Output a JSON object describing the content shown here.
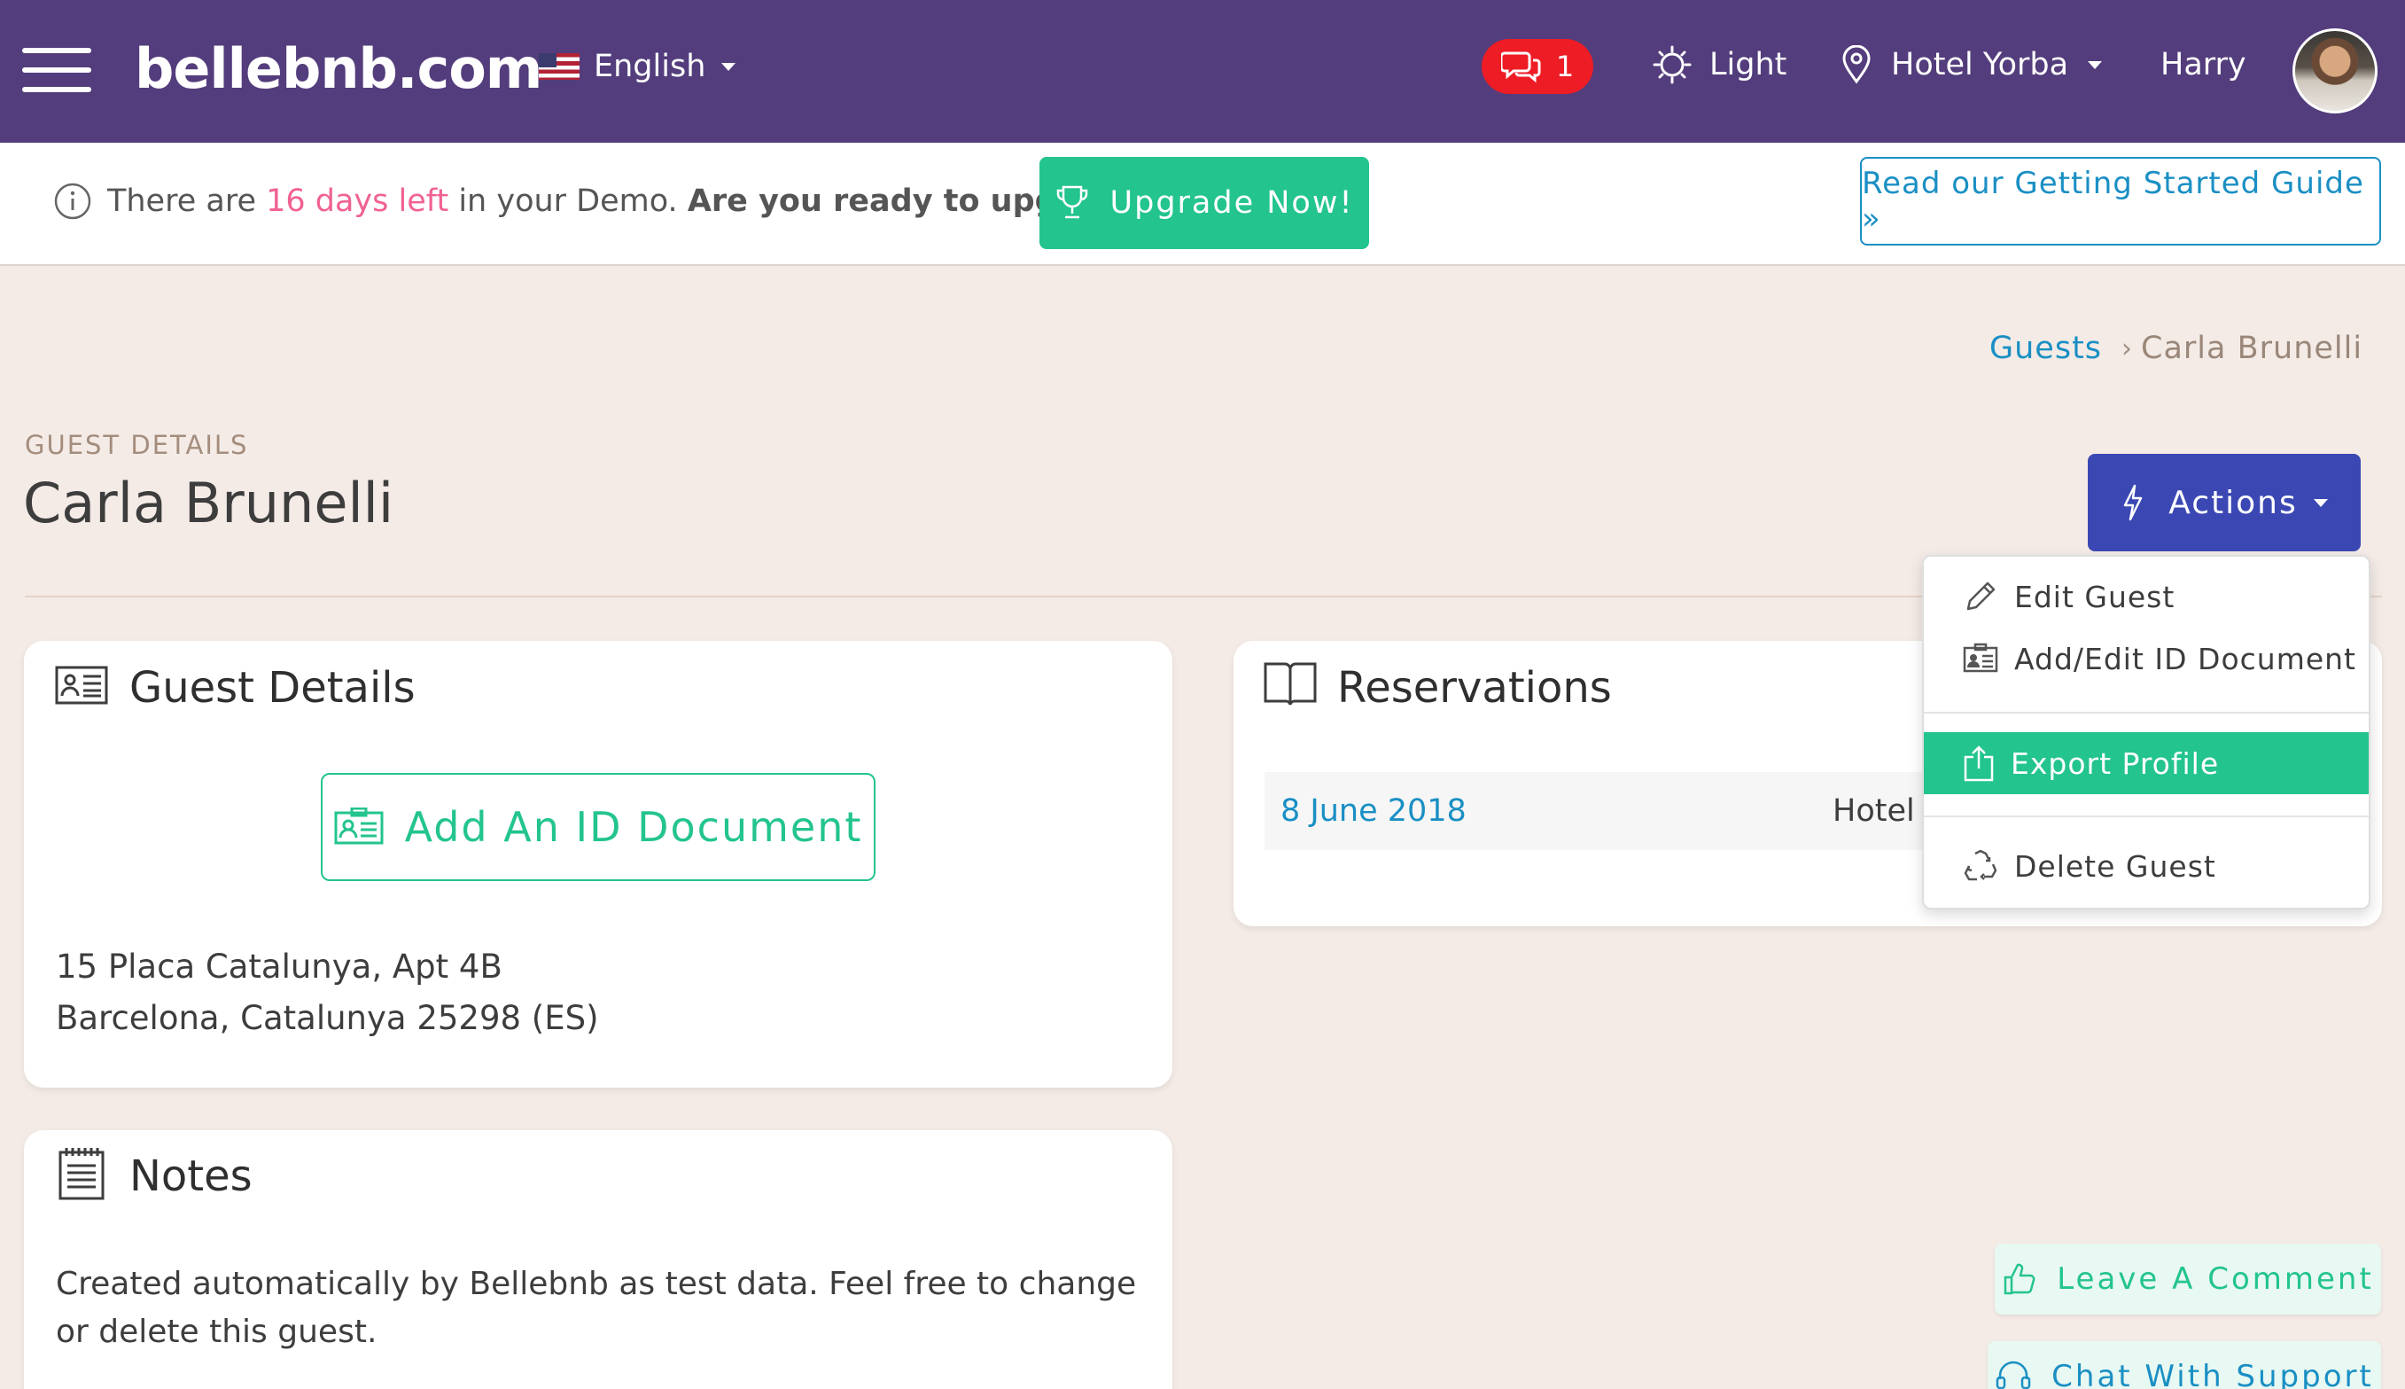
{
  "header": {
    "brand": "bellebnb.com",
    "language": "English",
    "chat_count": "1",
    "theme": "Light",
    "hotel": "Hotel Yorba",
    "user": "Harry",
    "icons": [
      "menu-icon",
      "flag-us-icon",
      "chat-icon",
      "sun-icon",
      "location-pin-icon",
      "avatar"
    ]
  },
  "banner": {
    "prefix": "There are ",
    "days_left": "16 days left",
    "middle": " in your Demo. ",
    "ask": "Are you ready to upgrade?",
    "upgrade_label": "Upgrade Now!",
    "guide_label": "Read our Getting Started Guide »"
  },
  "breadcrumb": {
    "parent": "Guests",
    "separator": "›",
    "current": "Carla Brunelli"
  },
  "page": {
    "section_label": "GUEST DETAILS",
    "title": "Carla Brunelli",
    "actions_label": "Actions"
  },
  "guest_card": {
    "title": "Guest Details",
    "add_id_label": "Add An ID Document",
    "address_line1": "15 Placa Catalunya, Apt 4B",
    "address_line2": "Barcelona, Catalunya 25298 (ES)"
  },
  "reservations_card": {
    "title": "Reservations",
    "rows": [
      {
        "date": "8 June 2018",
        "hotel": "Hotel Y"
      }
    ]
  },
  "notes_card": {
    "title": "Notes",
    "text": "Created automatically by Bellebnb as test data. Feel free to change or delete this guest."
  },
  "actions_menu": {
    "edit_guest": "Edit Guest",
    "edit_id": "Add/Edit ID Document",
    "export_profile": "Export Profile",
    "delete_guest": "Delete Guest"
  },
  "floating": {
    "comment_label": "Leave A Comment",
    "support_label": "Chat With Support"
  },
  "colors": {
    "navbar": "#533d7c",
    "accent_green": "#23c48e",
    "link_blue": "#1a8fc4",
    "actions_blue": "#3b48b4",
    "badge_red": "#ee1c25",
    "days_pink": "#f06292",
    "page_bg": "#f4ebe6"
  }
}
